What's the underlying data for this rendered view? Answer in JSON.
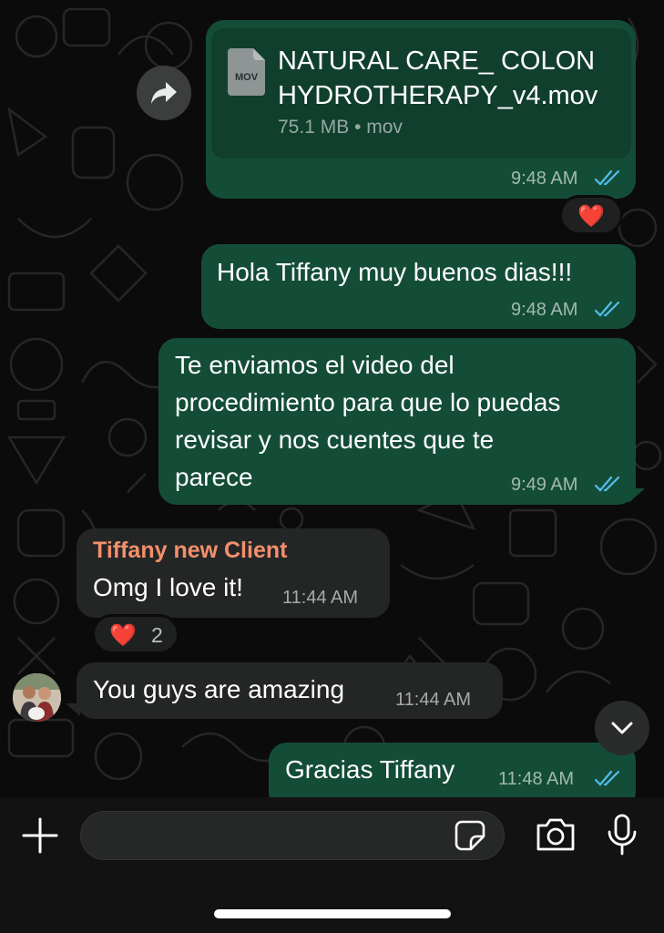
{
  "colors": {
    "outgoing_bubble": "#144d37",
    "incoming_bubble": "#242626",
    "sender_name": "#f48f6c",
    "read_ticks": "#53bdeb",
    "background": "#0b0b0b"
  },
  "messages": [
    {
      "direction": "outgoing",
      "type": "file",
      "file_badge": "MOV",
      "file_name_line1": "NATURAL CARE_ COLON",
      "file_name_line2": "HYDROTHERAPY_v4.mov",
      "file_meta": "75.1 MB • mov",
      "time": "9:48 AM",
      "status_icon": "double-check-read-icon",
      "reaction": {
        "emoji": "❤️"
      },
      "forward_icon": "forward-arrow-icon"
    },
    {
      "direction": "outgoing",
      "text": "Hola Tiffany muy buenos dias!!!",
      "time": "9:48 AM",
      "status_icon": "double-check-read-icon"
    },
    {
      "direction": "outgoing",
      "lines": [
        "Te enviamos el video del",
        "procedimiento para que lo puedas",
        "revisar y nos cuentes que te",
        "parece"
      ],
      "time": "9:49 AM",
      "status_icon": "double-check-read-icon"
    },
    {
      "direction": "incoming",
      "sender": "Tiffany new Client",
      "text": "Omg I love it!",
      "time": "11:44 AM",
      "reaction": {
        "emoji": "❤️",
        "count": "2"
      }
    },
    {
      "direction": "incoming",
      "text": "You guys are amazing",
      "time": "11:44 AM"
    },
    {
      "direction": "outgoing",
      "text": "Gracias Tiffany",
      "time": "11:48 AM",
      "status_icon": "double-check-read-icon"
    }
  ],
  "composer": {
    "placeholder": "",
    "icons": [
      "plus-icon",
      "sticker-icon",
      "camera-icon",
      "microphone-icon"
    ]
  },
  "scroll_down_icon": "chevron-down-icon"
}
